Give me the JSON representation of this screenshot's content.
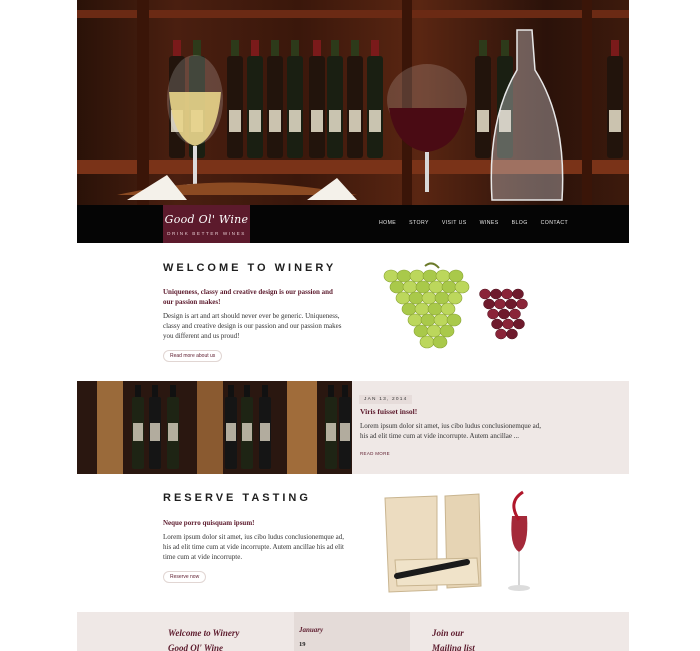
{
  "brand": {
    "name": "Good Ol' Wine",
    "tagline": "DRINK BETTER WINES"
  },
  "nav": {
    "items": [
      "HOME",
      "STORY",
      "VISIT US",
      "WINES",
      "BLOG",
      "CONTACT"
    ]
  },
  "welcome": {
    "title": "WELCOME TO WINERY",
    "lead": "Uniqueness, classy and creative design is our passion and our passion makes!",
    "body": "Design is art and art should never ever be generic. Uniqueness, classy and creative design is our passion and our passion makes you different and us proud!",
    "button": "Read more about us"
  },
  "post": {
    "date": "JAN 13, 2014",
    "title": "Viris fuisset insol!",
    "body": "Lorem ipsum dolor sit amet, ius cibo ludus conclusionemque ad, his ad elit time cum at vide incorrupte. Autem ancillae ...",
    "read_more": "READ MORE"
  },
  "tasting": {
    "title": "RESERVE TASTING",
    "lead": "Neque porro quisquam ipsum!",
    "body": "Lorem ipsum dolor sit amet, ius cibo ludus conclusionemque ad, his ad elit time cum at vide incorrupte. Autem ancillae his ad elit time cum at vide incorrupte.",
    "button": "Reserve now"
  },
  "footer": {
    "welcome_line1": "Welcome to Winery",
    "welcome_line2": "Good Ol' Wine",
    "month": "January",
    "day": "19",
    "mailing_line1": "Join our",
    "mailing_line2": "Mailing list"
  },
  "colors": {
    "accent": "#5c1a2c",
    "band": "#efe8e6",
    "nav": "#050505"
  }
}
